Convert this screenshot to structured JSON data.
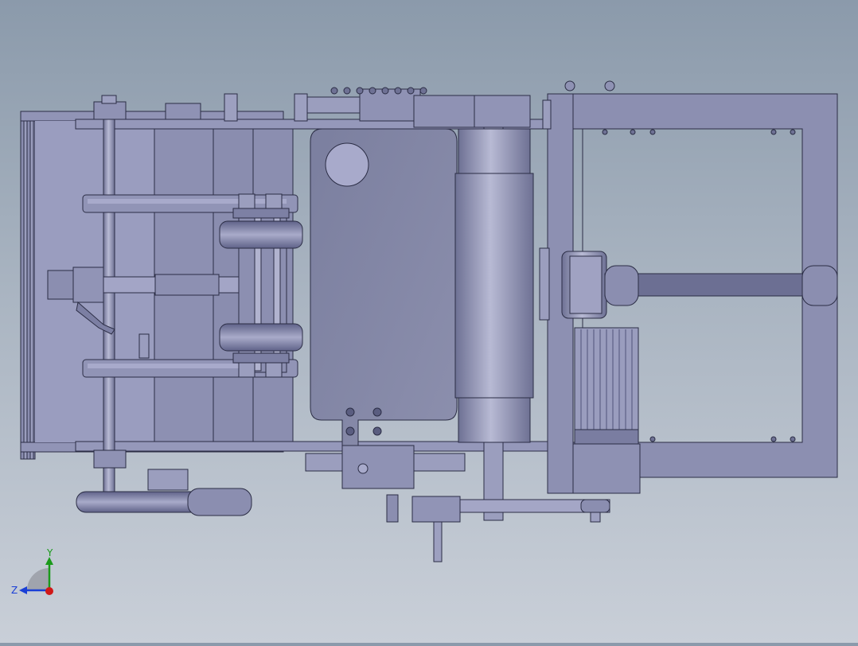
{
  "triad": {
    "y_label": "Y",
    "z_label": "Z",
    "y_color": "#1a9a1a",
    "z_color": "#1a3fd6",
    "x_color": "#d01818"
  },
  "colors": {
    "background_top": "#8b9aab",
    "background_bottom": "#c9cfd8",
    "part_fill": "#8f92b4",
    "part_dark": "#6f7296",
    "part_light": "#b4b6d0",
    "edge": "#2b2d45"
  }
}
